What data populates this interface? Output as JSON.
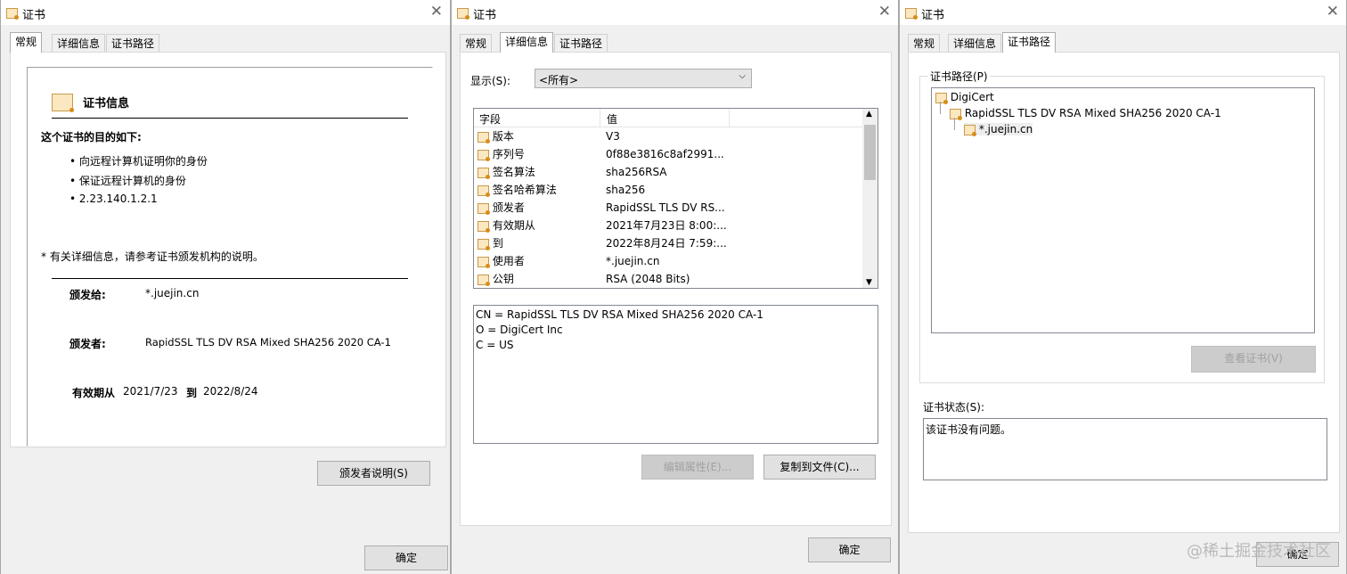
{
  "windows": [
    {
      "title": "证书",
      "tabs": [
        "常规",
        "详细信息",
        "证书路径"
      ],
      "active_tab": 0,
      "general": {
        "heading": "证书信息",
        "purpose_title": "这个证书的目的如下:",
        "purposes": [
          "• 向远程计算机证明你的身份",
          "• 保证远程计算机的身份",
          "• 2.23.140.1.2.1"
        ],
        "note": "* 有关详细信息，请参考证书颁发机构的说明。",
        "issued_to_label": "颁发给:",
        "issued_to": "*.juejin.cn",
        "issued_by_label": "颁发者:",
        "issued_by": "RapidSSL TLS DV RSA Mixed SHA256 2020 CA-1",
        "valid_label": "有效期从",
        "valid_from": "2021/7/23",
        "valid_to_label": "到",
        "valid_to": "2022/8/24",
        "issuer_statement_button": "颁发者说明(S)"
      },
      "ok_button": "确定"
    },
    {
      "title": "证书",
      "tabs": [
        "常规",
        "详细信息",
        "证书路径"
      ],
      "active_tab": 1,
      "details": {
        "show_label": "显示(S):",
        "show_value": "<所有>",
        "col_field": "字段",
        "col_value": "值",
        "rows": [
          {
            "field": "版本",
            "value": "V3"
          },
          {
            "field": "序列号",
            "value": "0f88e3816c8af2991..."
          },
          {
            "field": "签名算法",
            "value": "sha256RSA"
          },
          {
            "field": "签名哈希算法",
            "value": "sha256"
          },
          {
            "field": "颁发者",
            "value": "RapidSSL TLS DV RS..."
          },
          {
            "field": "有效期从",
            "value": "2021年7月23日 8:00:..."
          },
          {
            "field": "到",
            "value": "2022年8月24日 7:59:..."
          },
          {
            "field": "使用者",
            "value": "*.juejin.cn"
          },
          {
            "field": "公钥",
            "value": "RSA (2048 Bits)"
          }
        ],
        "detail_lines": [
          "CN = RapidSSL TLS DV RSA Mixed SHA256 2020 CA-1",
          "O = DigiCert Inc",
          "C = US"
        ],
        "edit_button": "编辑属性(E)...",
        "copy_button": "复制到文件(C)..."
      },
      "ok_button": "确定"
    },
    {
      "title": "证书",
      "tabs": [
        "常规",
        "详细信息",
        "证书路径"
      ],
      "active_tab": 2,
      "path": {
        "group_label": "证书路径(P)",
        "nodes": [
          "DigiCert",
          "RapidSSL TLS DV RSA Mixed SHA256 2020 CA-1",
          "*.juejin.cn"
        ],
        "view_button": "查看证书(V)",
        "status_label": "证书状态(S):",
        "status_text": "该证书没有问题。"
      },
      "ok_button": "确定"
    }
  ],
  "watermark": "@稀土掘金技术社区"
}
